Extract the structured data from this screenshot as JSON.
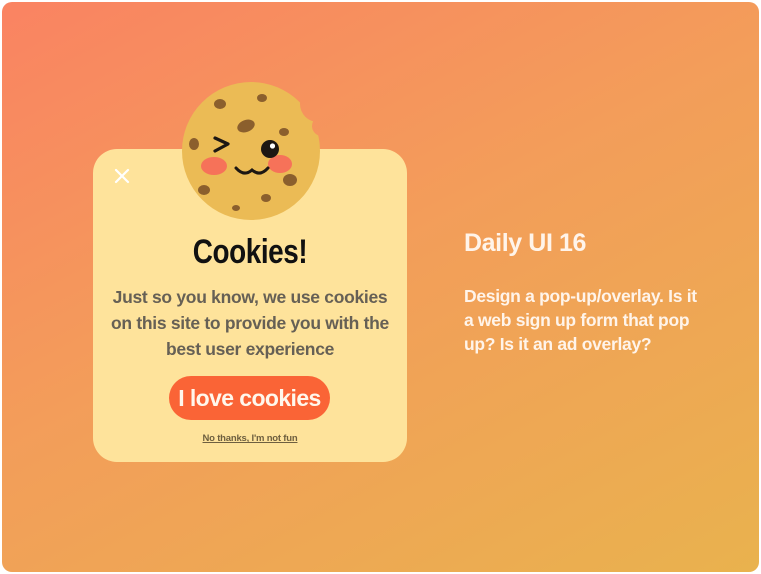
{
  "popup": {
    "title": "Cookies!",
    "message": "Just so you know, we use cookies on this site to provide you with the best user experience",
    "accept_label": "I love cookies",
    "decline_label": "No thanks, I'm not fun",
    "close_icon": "close-icon",
    "illustration": "winking-cookie-icon"
  },
  "side": {
    "title": "Daily UI 16",
    "description": "Design a pop-up/overlay. Is it a web sign up form that pop up? Is it an ad overlay?"
  },
  "colors": {
    "background_start": "#fa8362",
    "background_end": "#e9b24e",
    "popup_background": "#fee39b",
    "accept_button": "#fa6436",
    "cookie_dough": "#ebbb55",
    "chocolate_chip": "#8b5f2d",
    "blush": "#f8655a"
  }
}
